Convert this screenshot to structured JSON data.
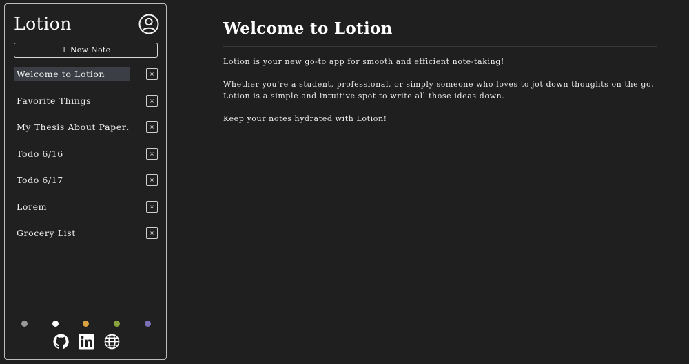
{
  "app": {
    "brand": "Lotion",
    "new_note_label": "+ New Note"
  },
  "notes": [
    {
      "title": "Welcome to Lotion",
      "active": true
    },
    {
      "title": "Favorite Things",
      "active": false
    },
    {
      "title": "My Thesis About Paper…",
      "active": false
    },
    {
      "title": "Todo 6/16",
      "active": false
    },
    {
      "title": "Todo 6/17",
      "active": false
    },
    {
      "title": "Lorem",
      "active": false
    },
    {
      "title": "Grocery List",
      "active": false
    }
  ],
  "delete_glyph": "×",
  "theme_colors": [
    "#9a9a9a",
    "#ffffff",
    "#d9a440",
    "#8aa63a",
    "#7c6fb5"
  ],
  "socials": [
    "github-icon",
    "linkedin-icon",
    "globe-icon"
  ],
  "document": {
    "title": "Welcome to Lotion",
    "paragraphs": [
      "Lotion is your new go-to app for smooth and efficient note-taking!",
      "Whether you're a student, professional, or simply someone who loves to jot down thoughts on the go, Lotion is a simple and intuitive spot to write all those ideas down.",
      "Keep your notes hydrated with Lotion!"
    ]
  }
}
